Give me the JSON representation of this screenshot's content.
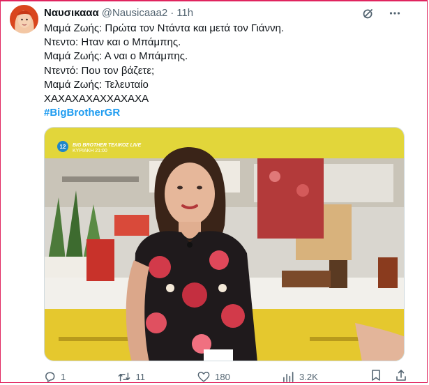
{
  "tweet": {
    "display_name": "Ναυσικααα",
    "handle": "@Nausicaaa2",
    "separator": "·",
    "time": "11h",
    "lines": [
      "Μαμά Ζωής: Πρώτα τον Ντάντα και μετά τον Γιάννη.",
      "Ντεντο: Ηταν και ο Μπάμπης.",
      "Μαμά Ζωής: Α ναι ο Μπάμπης.",
      "Ντεντό: Που τον βάζετε;",
      "Μαμά Ζωής: Τελευταίο",
      "ΧΑΧΑΧΑΧΑΧΧΑΧΑΧΑ"
    ],
    "hashtag": "#BigBrotherGR"
  },
  "media": {
    "channel_number": "12",
    "banner_title": "BIG BROTHER ΤΕΛΙΚΟΣ LIVE",
    "banner_subtitle": "ΚΥΡΙΑΚΗ 21:00",
    "banner_color": "#e2d63a"
  },
  "actions": {
    "replies": "1",
    "reposts": "11",
    "likes": "180",
    "views": "3.2K"
  },
  "colors": {
    "accent": "#1d9bf0",
    "text_secondary": "#536471",
    "frame_border": "#e0245e"
  },
  "icons": [
    "grok-icon",
    "more-icon",
    "reply-icon",
    "repost-icon",
    "like-icon",
    "views-icon",
    "bookmark-icon",
    "share-icon"
  ]
}
